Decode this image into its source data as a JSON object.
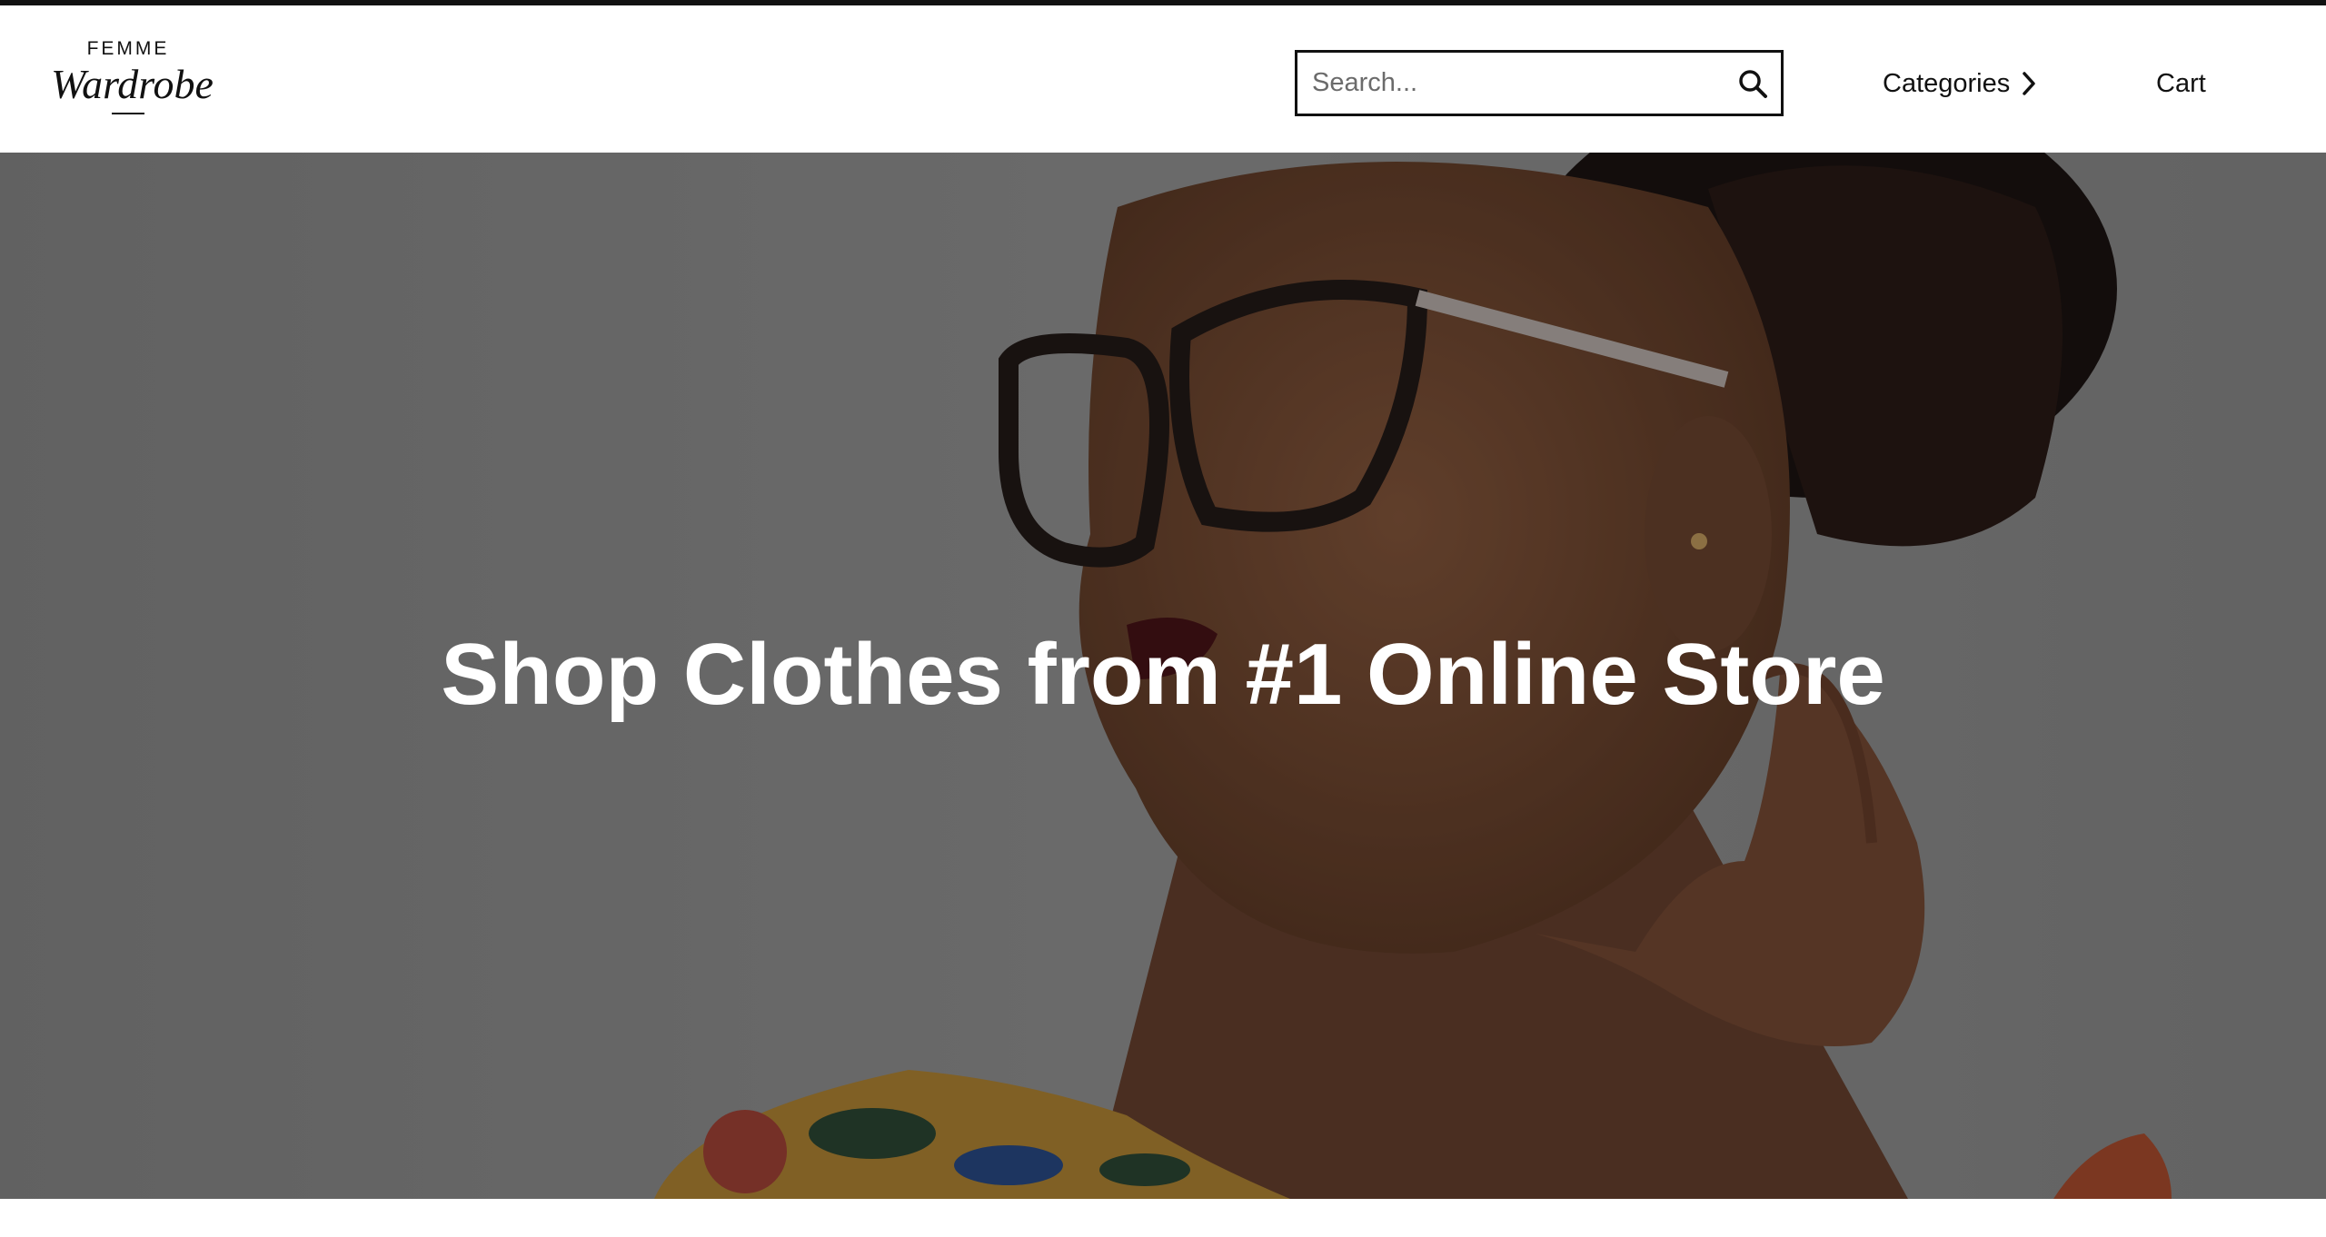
{
  "brand": {
    "top": "FEMME",
    "main": "Wardrobe"
  },
  "search": {
    "placeholder": "Search...",
    "value": "",
    "icon": "search-icon"
  },
  "nav": {
    "categories_label": "Categories",
    "categories_icon": "chevron-right-icon",
    "cart_label": "Cart"
  },
  "hero": {
    "title": "Shop Clothes from #1 Online Store",
    "image": "woman-with-glasses-photo"
  },
  "colors": {
    "text": "#111111",
    "background": "#ffffff",
    "hero_text": "#ffffff"
  }
}
